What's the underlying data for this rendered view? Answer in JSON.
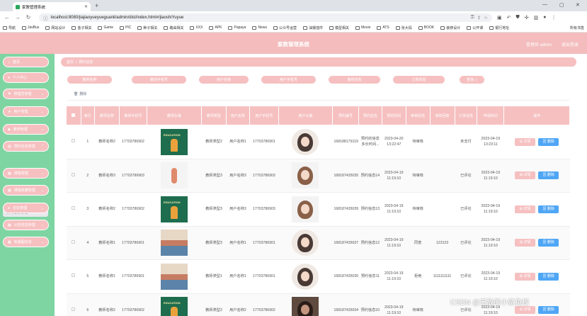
{
  "browser": {
    "tab_title": "家教管理系统",
    "url": "localhost:8080/jiajiaoyueyueguanli/admin/dist/index.html#/jiaoshiYuyue",
    "bookmarks": [
      "导航",
      "JavBus",
      "网站设计",
      "金子相关",
      "Game",
      "PIC",
      "种子相关",
      "路由相关",
      "XXX",
      "APK",
      "Papaya",
      "News",
      "公众号运营",
      "油猴插件",
      "模型相关",
      "Movie",
      "ATS",
      "张大妈",
      "BOOK",
      "装修设计",
      "公开课",
      "银行地址"
    ],
    "bookmarks_more": "所有书签"
  },
  "header": {
    "title": "家教管理系统",
    "user": "管理员 admin",
    "logout": "退出登录"
  },
  "sidebar": {
    "items": [
      {
        "icon": "⌂",
        "label": "首页",
        "arrow": ""
      },
      {
        "icon": "●",
        "label": "个人中心",
        "arrow": "⌄"
      },
      {
        "icon": "⚑",
        "label": "管理员管理",
        "arrow": "⌄"
      },
      {
        "icon": "★",
        "label": "用户管理",
        "arrow": "⌄"
      },
      {
        "icon": "◆",
        "label": "教师管理",
        "arrow": "⌄"
      },
      {
        "icon": "▤",
        "label": "预约信息管理",
        "arrow": "⌃"
      },
      {
        "icon": "▦",
        "label": "课程管理",
        "arrow": "⌄"
      },
      {
        "icon": "▦",
        "label": "课程收藏管理",
        "arrow": "⌄"
      },
      {
        "icon": "●",
        "label": "论坛管理",
        "arrow": "⌄"
      },
      {
        "icon": "▦",
        "label": "公告信息管理",
        "arrow": "⌄"
      },
      {
        "icon": "▦",
        "label": "轮播图信息",
        "arrow": "⌄"
      }
    ],
    "subitem": "预约信息管理"
  },
  "breadcrumb": {
    "home": "首页",
    "sep": "/",
    "current": "预约信息"
  },
  "filters": [
    "教师名称",
    "教师手机号",
    "用户名称",
    "用户手机号",
    "审核状态",
    "订单状态"
  ],
  "search_button": "查询",
  "delete_button": "删除",
  "table": {
    "headers": [
      "",
      "索引",
      "教师名称",
      "教师手机号",
      "教师头像",
      "教师类型",
      "用户名称",
      "用户手机号",
      "用户头像",
      "预约编号",
      "预约信息",
      "预约时间",
      "审核状态",
      "审核回复",
      "订单状态",
      "申请时间",
      "操作"
    ],
    "detail_label": "详情",
    "delete_label": "删除",
    "rows": [
      {
        "idx": "1",
        "teacher": "教师名称2",
        "tphone": "17703786902",
        "tpic": "edu",
        "ttype": "教师类型2",
        "user": "用户名称1",
        "uphone": "17703786901",
        "upic": "a",
        "no": "1681881791194",
        "info": "预约的信息多长时间...",
        "time": "2023-04-20 13:22:47",
        "status": "待审核",
        "reply": "",
        "order": "未支付",
        "apply": "2023-04-19 13:23:11"
      },
      {
        "idx": "2",
        "teacher": "教师名称3",
        "tphone": "17703786903",
        "tpic": "white",
        "ttype": "教师类型3",
        "user": "用户名称3",
        "uphone": "17703786903",
        "upic": "b",
        "no": "1681874350350",
        "info": "预约信息14",
        "time": "2023-04-19 11:19:10",
        "status": "待审核",
        "reply": "",
        "order": "已评论",
        "apply": "2023-04-19 11:19:10"
      },
      {
        "idx": "3",
        "teacher": "教师名称2",
        "tphone": "17703786902",
        "tpic": "edu",
        "ttype": "教师类型3",
        "user": "用户名称3",
        "uphone": "17703786903",
        "upic": "b",
        "no": "1681874350391",
        "info": "预约信息13",
        "time": "2023-04-19 11:19:10",
        "status": "待审核",
        "reply": "",
        "order": "已评论",
        "apply": "2023-04-19 11:19:10"
      },
      {
        "idx": "4",
        "teacher": "教师名称1",
        "tphone": "17703786901",
        "tpic": "class",
        "ttype": "教师类型3",
        "user": "用户名称1",
        "uphone": "17703786901",
        "upic": "a",
        "no": "1681874350373",
        "info": "预约信息12",
        "time": "2023-04-19 11:19:10",
        "status": "同意",
        "reply": "123123",
        "order": "已评论",
        "apply": "2023-04-19 11:19:10"
      },
      {
        "idx": "5",
        "teacher": "教师名称1",
        "tphone": "17703786901",
        "tpic": "class",
        "ttype": "教师类型1",
        "user": "用户名称1",
        "uphone": "17703786901",
        "upic": "a",
        "no": "1681874350355",
        "info": "预约信息11",
        "time": "2023-04-19 11:19:10",
        "status": "拒绝",
        "reply": "1111111111",
        "order": "已评论",
        "apply": "2023-04-19 11:19:10"
      },
      {
        "idx": "6",
        "teacher": "教师名称2",
        "tphone": "17703786902",
        "tpic": "edu",
        "ttype": "教师类型2",
        "user": "用户名称2",
        "uphone": "17703786902",
        "upic": "photo",
        "no": "1681874350341",
        "info": "预约信息10",
        "time": "2023-04-19 11:19:10",
        "status": "待审核",
        "reply": "",
        "order": "已评论",
        "apply": "2023-04-19 11:19:10"
      }
    ]
  },
  "watermark": "CSDN @无敌的小鲨鱼蛟",
  "colors": {
    "primary_pink": "#f6c0c1",
    "sidebar_green": "#7ed5a2",
    "delete_blue": "#4fa6f5"
  }
}
